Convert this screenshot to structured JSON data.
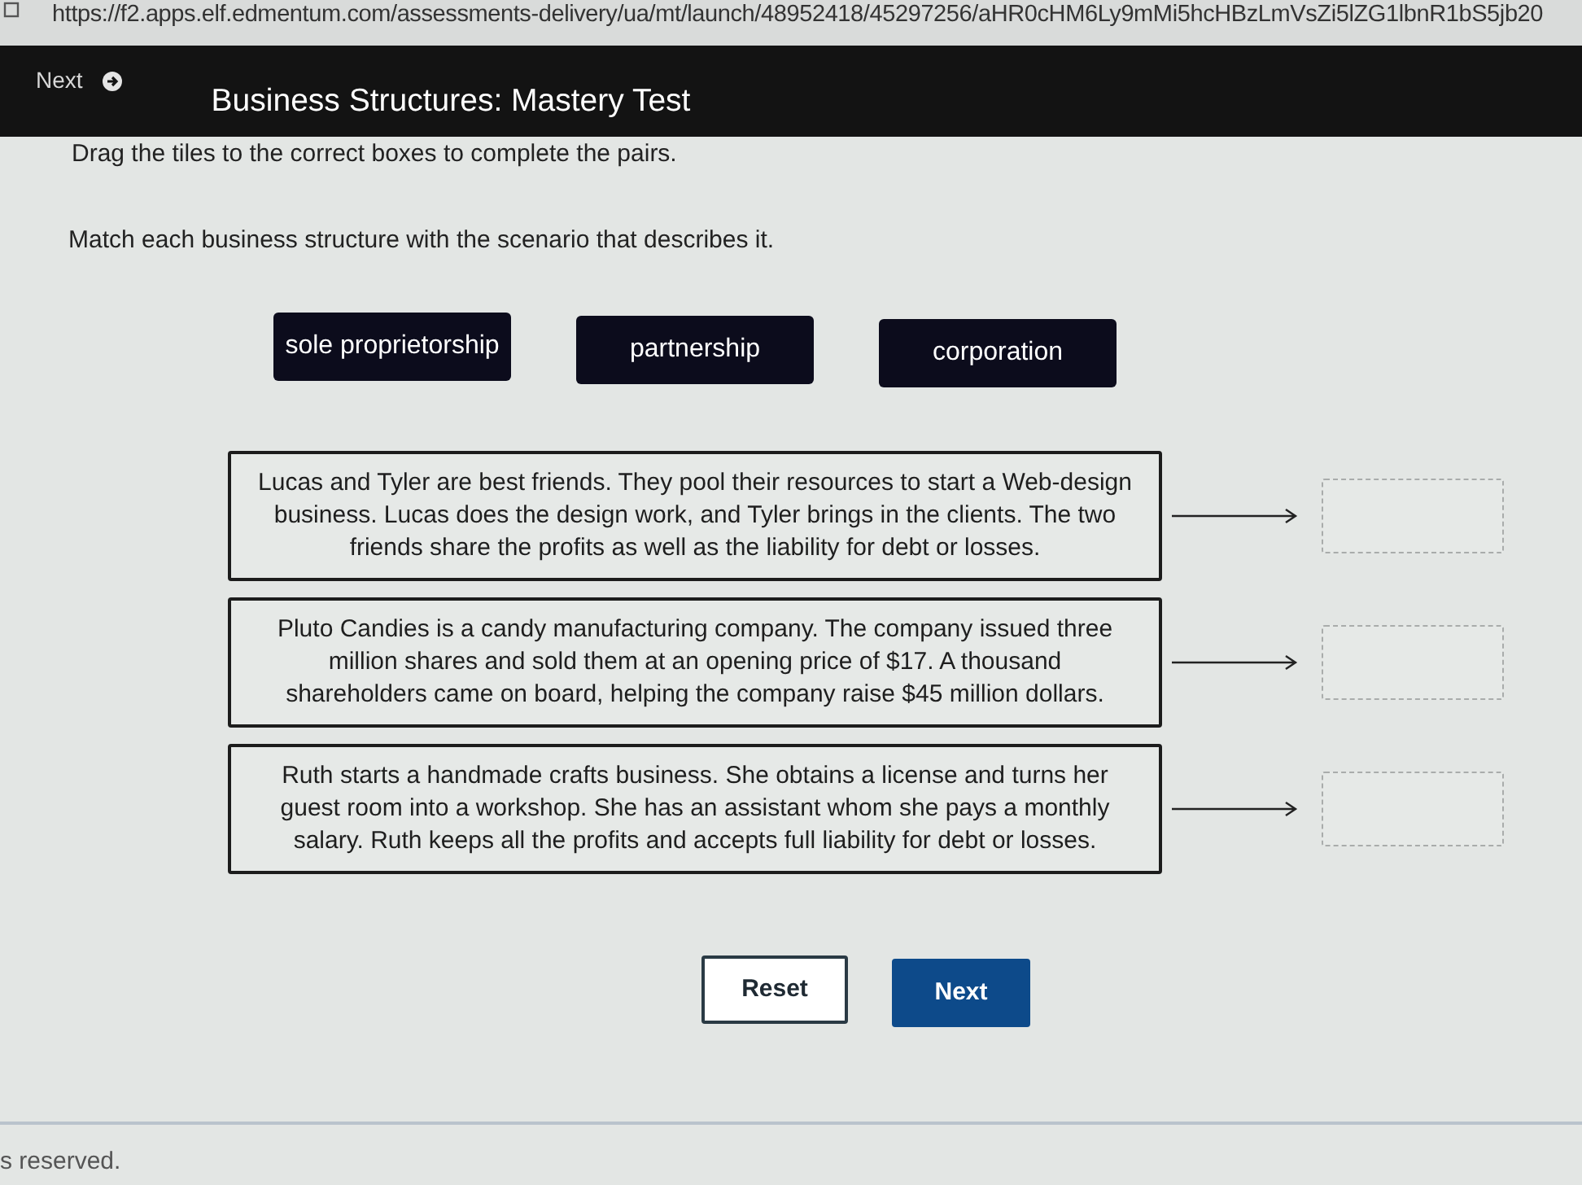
{
  "address_bar": {
    "url": "https://f2.apps.elf.edmentum.com/assessments-delivery/ua/mt/launch/48952418/45297256/aHR0cHM6Ly9mMi5hcHBzLmVsZi5lZG1lbnR1bS5jb20"
  },
  "header": {
    "nav_button": "Next",
    "title": "Business Structures: Mastery Test"
  },
  "instructions": [
    "Drag the tiles to the correct boxes to complete the pairs.",
    "Match each business structure with the scenario that describes it."
  ],
  "tiles": [
    {
      "label": "sole proprietorship"
    },
    {
      "label": "partnership"
    },
    {
      "label": "corporation"
    }
  ],
  "pairs": [
    {
      "scenario_lines": [
        "Lucas and Tyler are best friends. They pool their resources to start a Web-design",
        "business. Lucas does the design work, and Tyler brings in the clients. The two",
        "friends share the profits as well as the liability for debt or losses."
      ]
    },
    {
      "scenario_lines": [
        "Pluto Candies is a candy manufacturing company. The company issued three",
        "million shares and sold them at an opening price of $17. A thousand",
        "shareholders came on board, helping the company raise $45 million dollars."
      ]
    },
    {
      "scenario_lines": [
        "Ruth starts a handmade crafts business. She obtains a license and turns her",
        "guest room into a workshop. She has an assistant whom she pays a monthly",
        "salary. Ruth keeps all the profits and accepts full liability for debt or losses."
      ]
    }
  ],
  "buttons": [
    {
      "label": "Reset",
      "kind": "secondary"
    },
    {
      "label": "Next",
      "kind": "primary"
    }
  ],
  "footer": {
    "text": "s reserved."
  }
}
